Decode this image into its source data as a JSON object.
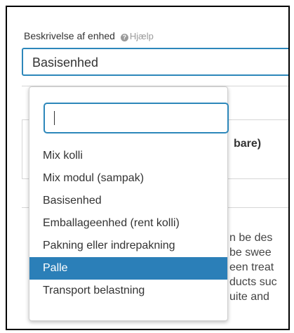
{
  "field": {
    "label": "Beskrivelse af enhed",
    "help_label": "Hjælp",
    "value": "Basisenhed"
  },
  "background": {
    "heading_fragment": "bare)",
    "paragraph_fragments": [
      "n be des",
      "be swee",
      "een treat",
      "ducts suc",
      "uite and"
    ]
  },
  "dropdown": {
    "search_value": "",
    "selected_index": 5,
    "options": [
      "Mix kolli",
      "Mix modul (sampak)",
      "Basisenhed",
      "Emballageenhed (rent kolli)",
      "Pakning eller indrepakning",
      "Palle",
      "Transport belastning"
    ]
  },
  "colors": {
    "accent": "#2d87ba",
    "selected_bg": "#2b7fb8"
  },
  "icons": {
    "help": "question-circle-icon"
  }
}
